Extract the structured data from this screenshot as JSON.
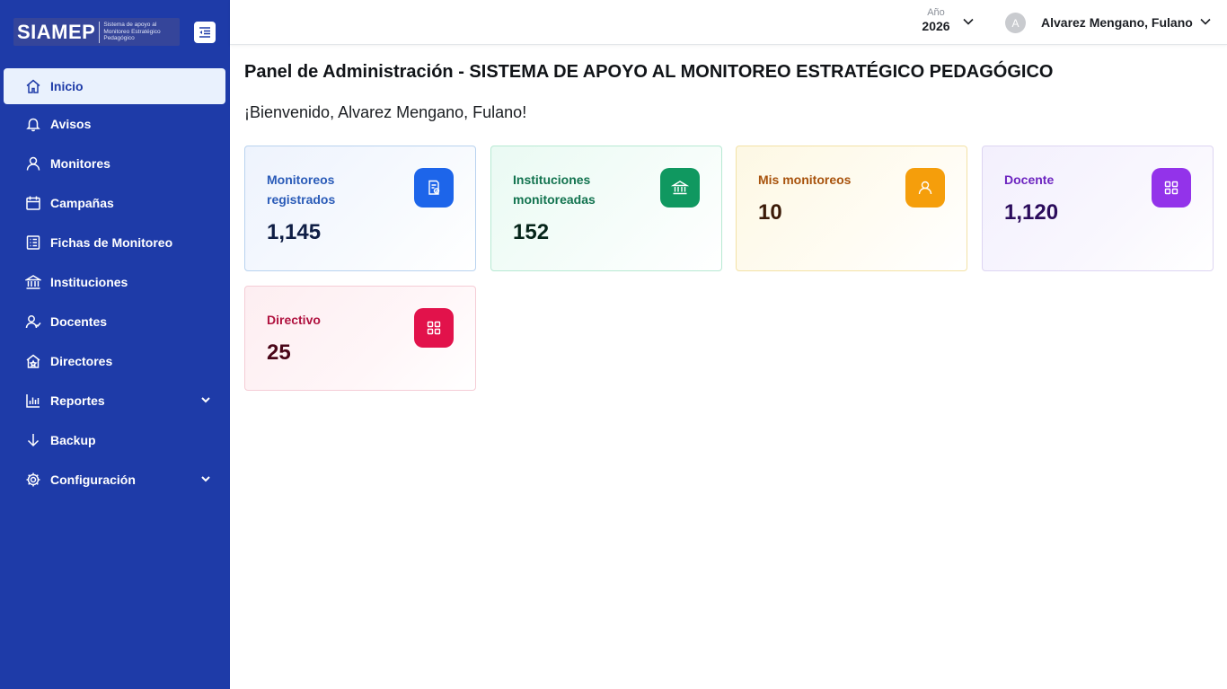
{
  "sidebar": {
    "brand_name": "SIAMEP",
    "brand_subtitle": "Sistema de apoyo al Monitoreo Estratégico Pedagógico",
    "items": [
      {
        "label": "Inicio",
        "icon": "home-icon",
        "active": true
      },
      {
        "label": "Avisos",
        "icon": "bell-icon"
      },
      {
        "label": "Monitores",
        "icon": "user-icon"
      },
      {
        "label": "Campañas",
        "icon": "calendar-icon"
      },
      {
        "label": "Fichas de Monitoreo",
        "icon": "list-icon"
      },
      {
        "label": "Instituciones",
        "icon": "bank-icon"
      },
      {
        "label": "Docentes",
        "icon": "users-icon"
      },
      {
        "label": "Directores",
        "icon": "home-star-icon"
      },
      {
        "label": "Reportes",
        "icon": "bar-chart-icon",
        "expandable": true
      },
      {
        "label": "Backup",
        "icon": "arrow-down-icon"
      },
      {
        "label": "Configuración",
        "icon": "gear-icon",
        "expandable": true
      }
    ]
  },
  "header": {
    "year_label": "Año",
    "year_value": "2026",
    "user_initial": "A",
    "user_name": "Alvarez Mengano, Fulano"
  },
  "main": {
    "title": "Panel de Administración - SISTEMA DE APOYO AL MONITOREO ESTRATÉGICO PEDAGÓGICO",
    "welcome": "¡Bienvenido, Alvarez Mengano, Fulano!",
    "cards": [
      {
        "label": "Monitoreos registrados",
        "value": "1,145",
        "icon": "document-check-icon",
        "color": "#1d65ea"
      },
      {
        "label": "Instituciones monitoreadas",
        "value": "152",
        "icon": "bank-icon",
        "color": "#109860"
      },
      {
        "label": "Mis monitoreos",
        "value": "10",
        "icon": "user-icon",
        "color": "#f59e0b"
      },
      {
        "label": "Docente",
        "value": "1,120",
        "icon": "grid-icon",
        "color": "#9333ea"
      },
      {
        "label": "Directivo",
        "value": "25",
        "icon": "grid-icon",
        "color": "#e2124b"
      }
    ]
  }
}
